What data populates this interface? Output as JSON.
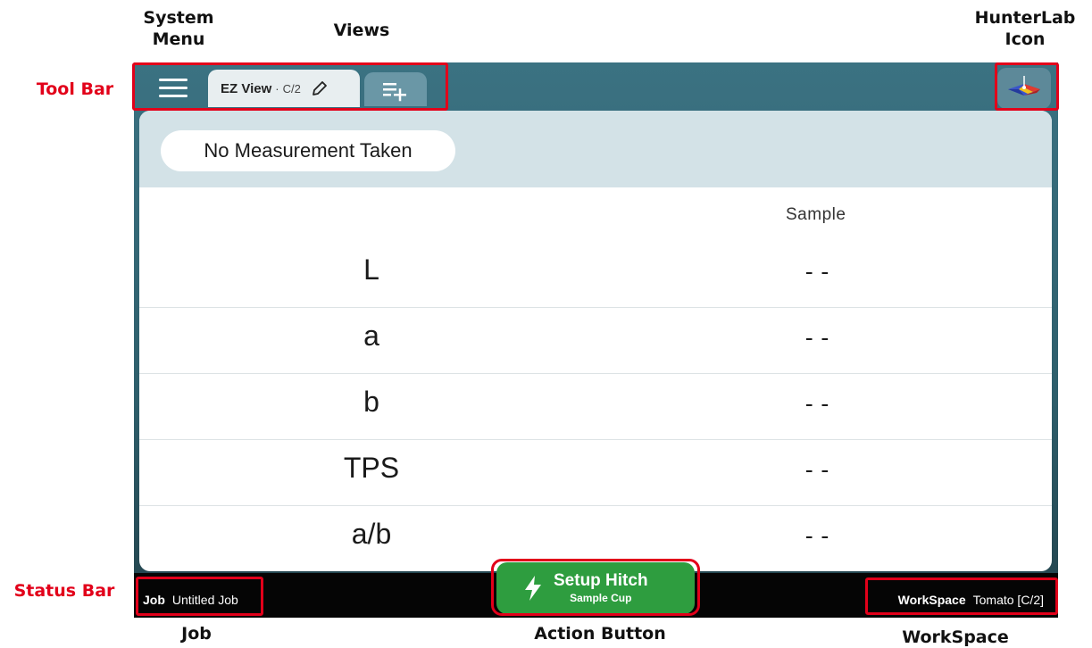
{
  "annotations": {
    "system_menu": "System\nMenu",
    "views": "Views",
    "hunterlab_icon": "HunterLab\nIcon",
    "tool_bar": "Tool Bar",
    "status_bar": "Status Bar",
    "job": "Job",
    "action_button": "Action Button",
    "workspace": "WorkSpace"
  },
  "toolbar": {
    "tab_name": "EZ View",
    "tab_separator": "·",
    "tab_suffix": "C/2"
  },
  "panel": {
    "status": "No Measurement Taken",
    "column_header": "Sample",
    "rows": [
      {
        "label": "L",
        "value": "--"
      },
      {
        "label": "a",
        "value": "--"
      },
      {
        "label": "b",
        "value": "--"
      },
      {
        "label": "TPS",
        "value": "--"
      },
      {
        "label": "a/b",
        "value": "--"
      }
    ]
  },
  "statusbar": {
    "job_key": "Job",
    "job_value": "Untitled Job",
    "workspace_key": "WorkSpace",
    "workspace_value": "Tomato [C/2]"
  },
  "action": {
    "title": "Setup Hitch",
    "subtitle": "Sample Cup"
  },
  "colors": {
    "annotation_red": "#e2001a",
    "toolbar": "#3b7282",
    "action_green": "#2e9d3f"
  }
}
